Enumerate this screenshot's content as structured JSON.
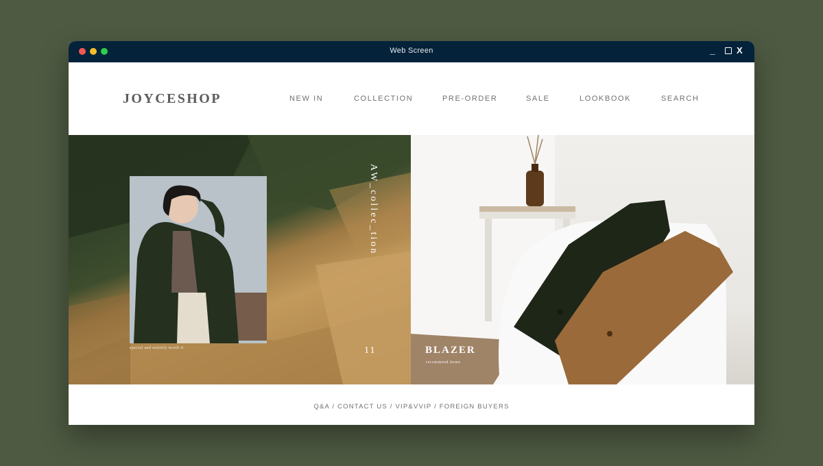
{
  "window": {
    "title": "Web Screen",
    "controls": {
      "minimize": "_",
      "close": "X"
    }
  },
  "header": {
    "logo": "JOYCESHOP",
    "nav": [
      "NEW IN",
      "COLLECTION",
      "PRE-ORDER",
      "SALE",
      "LOOKBOOK",
      "SEARCH"
    ]
  },
  "hero": {
    "left": {
      "vertical_text": "AW_collec_tion",
      "number": "11",
      "caption": "special and entirely worth it"
    },
    "right": {
      "title": "BLAZER",
      "subtitle": "recommend items"
    }
  },
  "footer": {
    "links": [
      "Q&A",
      "CONTACT US",
      "VIP&VVIP",
      "FOREIGN BUYERS"
    ],
    "separator": " / "
  }
}
